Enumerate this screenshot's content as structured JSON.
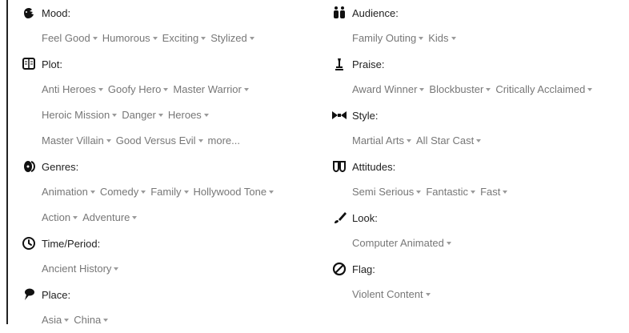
{
  "left": [
    {
      "id": "mood",
      "icon": "mood-icon",
      "label": "Mood:",
      "lines": [
        [
          {
            "text": "Feel Good"
          },
          {
            "text": "Humorous"
          },
          {
            "text": "Exciting"
          },
          {
            "text": "Stylized"
          }
        ]
      ]
    },
    {
      "id": "plot",
      "icon": "book-icon",
      "label": "Plot:",
      "lines": [
        [
          {
            "text": "Anti Heroes"
          },
          {
            "text": "Goofy Hero"
          },
          {
            "text": "Master Warrior"
          }
        ],
        [
          {
            "text": "Heroic Mission"
          },
          {
            "text": "Danger"
          },
          {
            "text": "Heroes"
          }
        ],
        [
          {
            "text": "Master Villain"
          },
          {
            "text": "Good Versus Evil"
          },
          {
            "text": "more...",
            "more": true
          }
        ]
      ]
    },
    {
      "id": "genres",
      "icon": "film-reel-icon",
      "label": "Genres:",
      "lines": [
        [
          {
            "text": "Animation"
          },
          {
            "text": "Comedy"
          },
          {
            "text": "Family"
          },
          {
            "text": "Hollywood Tone"
          }
        ],
        [
          {
            "text": "Action"
          },
          {
            "text": "Adventure"
          }
        ]
      ]
    },
    {
      "id": "time-period",
      "icon": "clock-icon",
      "label": "Time/Period:",
      "lines": [
        [
          {
            "text": "Ancient History"
          }
        ]
      ]
    },
    {
      "id": "place",
      "icon": "map-pin-icon",
      "label": "Place:",
      "lines": [
        [
          {
            "text": "Asia"
          },
          {
            "text": "China"
          }
        ]
      ]
    }
  ],
  "right": [
    {
      "id": "audience",
      "icon": "people-icon",
      "label": "Audience:",
      "lines": [
        [
          {
            "text": "Family Outing"
          },
          {
            "text": "Kids"
          }
        ]
      ]
    },
    {
      "id": "praise",
      "icon": "trophy-icon",
      "label": "Praise:",
      "lines": [
        [
          {
            "text": "Award Winner"
          },
          {
            "text": "Blockbuster"
          },
          {
            "text": "Critically Acclaimed"
          }
        ]
      ]
    },
    {
      "id": "style",
      "icon": "bowtie-icon",
      "label": "Style:",
      "lines": [
        [
          {
            "text": "Martial Arts"
          },
          {
            "text": "All Star Cast"
          }
        ]
      ]
    },
    {
      "id": "attitudes",
      "icon": "theater-mask-icon",
      "label": "Attitudes:",
      "lines": [
        [
          {
            "text": "Semi Serious"
          },
          {
            "text": "Fantastic"
          },
          {
            "text": "Fast"
          }
        ]
      ]
    },
    {
      "id": "look",
      "icon": "paintbrush-icon",
      "label": "Look:",
      "lines": [
        [
          {
            "text": "Computer Animated"
          }
        ]
      ]
    },
    {
      "id": "flag",
      "icon": "prohibited-icon",
      "label": "Flag:",
      "lines": [
        [
          {
            "text": "Violent Content"
          }
        ]
      ]
    }
  ],
  "colors": {
    "label": "#222222",
    "tag": "#777777",
    "caret": "#9a9a9a",
    "icon": "#111111"
  }
}
